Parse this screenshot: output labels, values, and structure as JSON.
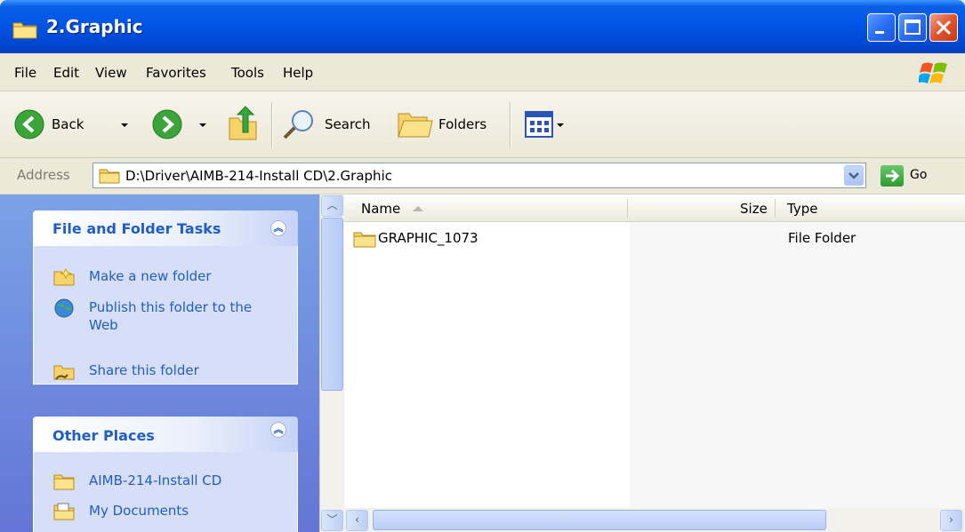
{
  "window": {
    "title": "2.Graphic"
  },
  "menu": [
    "File",
    "Edit",
    "View",
    "Favorites",
    "Tools",
    "Help"
  ],
  "toolbar": {
    "back_label": "Back",
    "search_label": "Search",
    "folders_label": "Folders"
  },
  "address": {
    "label": "Address",
    "path": "D:\\Driver\\AIMB-214-Install CD\\2.Graphic",
    "go_label": "Go"
  },
  "tasks_panel": {
    "title": "File and Folder Tasks",
    "items": [
      "Make a new folder",
      "Publish this folder to the Web",
      "Share this folder"
    ]
  },
  "places_panel": {
    "title": "Other Places",
    "items": [
      "AIMB-214-Install CD",
      "My Documents"
    ]
  },
  "list": {
    "columns": [
      "Name",
      "Size",
      "Type"
    ],
    "rows": [
      {
        "name": "GRAPHIC_1073",
        "size": "",
        "type": "File Folder"
      }
    ]
  },
  "colors": {
    "titlebar": "#0055E5",
    "task_link": "#215DC6",
    "pane_bg": "#6F8EDF"
  }
}
